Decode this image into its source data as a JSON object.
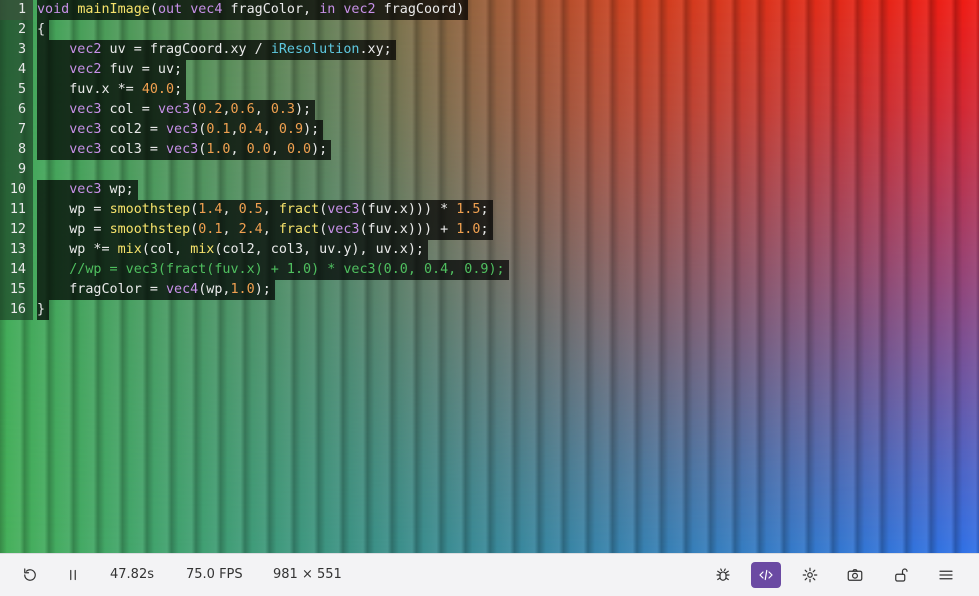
{
  "editor": {
    "lines": [
      {
        "n": "1",
        "html": "<span class='kw'>void</span> <span class='fn'>mainImage</span>(<span class='kw'>out</span> <span class='kw'>vec4</span> fragColor, <span class='kw'>in</span> <span class='kw'>vec2</span> fragCoord)"
      },
      {
        "n": "2",
        "html": "{"
      },
      {
        "n": "3",
        "html": "    <span class='kw'>vec2</span> uv = fragCoord.xy / <span class='bi'>iResolution</span>.xy;"
      },
      {
        "n": "4",
        "html": "    <span class='kw'>vec2</span> fuv = uv;"
      },
      {
        "n": "5",
        "html": "    fuv.x *= <span class='num'>40.0</span>;"
      },
      {
        "n": "6",
        "html": "    <span class='kw'>vec3</span> col = <span class='kw'>vec3</span>(<span class='num'>0.2</span>,<span class='num'>0.6</span>, <span class='num'>0.3</span>);"
      },
      {
        "n": "7",
        "html": "    <span class='kw'>vec3</span> col2 = <span class='kw'>vec3</span>(<span class='num'>0.1</span>,<span class='num'>0.4</span>, <span class='num'>0.9</span>);"
      },
      {
        "n": "8",
        "html": "    <span class='kw'>vec3</span> col3 = <span class='kw'>vec3</span>(<span class='num'>1.0</span>, <span class='num'>0.0</span>, <span class='num'>0.0</span>);"
      },
      {
        "n": "9",
        "html": ""
      },
      {
        "n": "10",
        "html": "    <span class='kw'>vec3</span> wp;"
      },
      {
        "n": "11",
        "html": "    wp = <span class='fn'>smoothstep</span>(<span class='num'>1.4</span>, <span class='num'>0.5</span>, <span class='fn'>fract</span>(<span class='kw'>vec3</span>(fuv.x))) * <span class='num'>1.5</span>;"
      },
      {
        "n": "12",
        "html": "    wp = <span class='fn'>smoothstep</span>(<span class='num'>0.1</span>, <span class='num'>2.4</span>, <span class='fn'>fract</span>(<span class='kw'>vec3</span>(fuv.x))) + <span class='num'>1.0</span>;"
      },
      {
        "n": "13",
        "html": "    wp *= <span class='fn'>mix</span>(col, <span class='fn'>mix</span>(col2, col3, uv.y), uv.x);"
      },
      {
        "n": "14",
        "html": "    <span class='cm'>//wp = vec3(fract(fuv.x) + 1.0) * vec3(0.0, 0.4, 0.9);</span>"
      },
      {
        "n": "15",
        "html": "    fragColor = <span class='kw'>vec4</span>(wp,<span class='num'>1.0</span>);"
      },
      {
        "n": "16",
        "html": "}"
      }
    ]
  },
  "status": {
    "time": "47.82s",
    "fps": "75.0 FPS",
    "resolution": "981 × 551"
  },
  "icons": {
    "reset": "reset-icon",
    "pause": "pause-icon",
    "debug": "bug-icon",
    "code": "code-icon",
    "settings": "gear-icon",
    "screenshot": "camera-icon",
    "lock": "unlock-icon",
    "menu": "menu-icon"
  },
  "colors": {
    "accent": "#6b4aa3"
  }
}
